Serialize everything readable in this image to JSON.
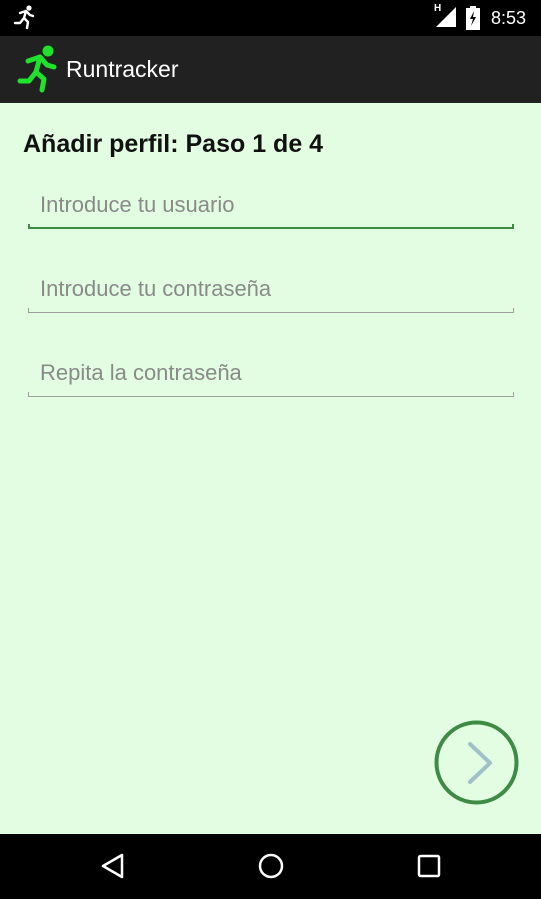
{
  "status_bar": {
    "time": "8:53",
    "network_label": "H",
    "icons": [
      "running-man-icon",
      "signal-icon",
      "battery-charging-icon"
    ]
  },
  "app_bar": {
    "title": "Runtracker",
    "logo_icon": "running-man-icon",
    "logo_color": "#1fe32a"
  },
  "main": {
    "heading": "Añadir perfil: Paso 1 de 4",
    "fields": [
      {
        "placeholder": "Introduce tu usuario",
        "value": ""
      },
      {
        "placeholder": "Introduce tu contraseña",
        "value": ""
      },
      {
        "placeholder": "Repita la contraseña",
        "value": ""
      }
    ],
    "next_icon": "chevron-right-icon"
  },
  "nav_bar": {
    "icons": [
      "back-triangle-icon",
      "home-circle-icon",
      "recents-square-icon"
    ]
  },
  "colors": {
    "background": "#e3fde3",
    "accent": "#3f8a45",
    "app_bar": "#212121"
  }
}
